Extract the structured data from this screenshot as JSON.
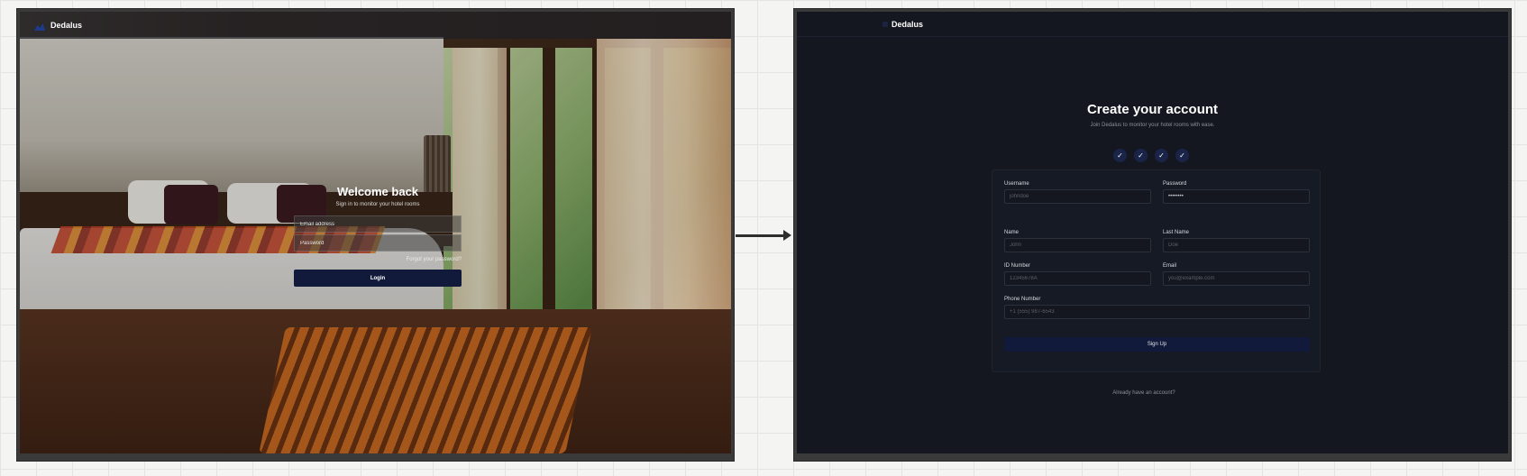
{
  "login": {
    "brand": "Dedalus",
    "title": "Welcome back",
    "subtitle": "Sign in to monitor your hotel rooms",
    "email_placeholder": "Email address",
    "password_placeholder": "Password",
    "forgot": "Forgot your password?",
    "login_label": "Login"
  },
  "signup": {
    "brand": "Dedalus",
    "title": "Create your account",
    "subtitle": "Join Dedalus to monitor your hotel rooms with ease.",
    "steps": [
      "✓",
      "✓",
      "✓",
      "✓"
    ],
    "fields": {
      "username": {
        "label": "Username",
        "placeholder": "johndoe"
      },
      "password": {
        "label": "Password",
        "value": "••••••••"
      },
      "name": {
        "label": "Name",
        "placeholder": "John"
      },
      "last_name": {
        "label": "Last Name",
        "placeholder": "Doe"
      },
      "id_number": {
        "label": "ID Number",
        "placeholder": "12345678A"
      },
      "email": {
        "label": "Email",
        "placeholder": "you@example.com"
      },
      "phone": {
        "label": "Phone Number",
        "placeholder": "+1 (555) 987-6543"
      }
    },
    "signup_label": "Sign Up",
    "already": "Already have an account?"
  },
  "colors": {
    "accent_button": "#111a3a",
    "dark_background": "#141720"
  }
}
